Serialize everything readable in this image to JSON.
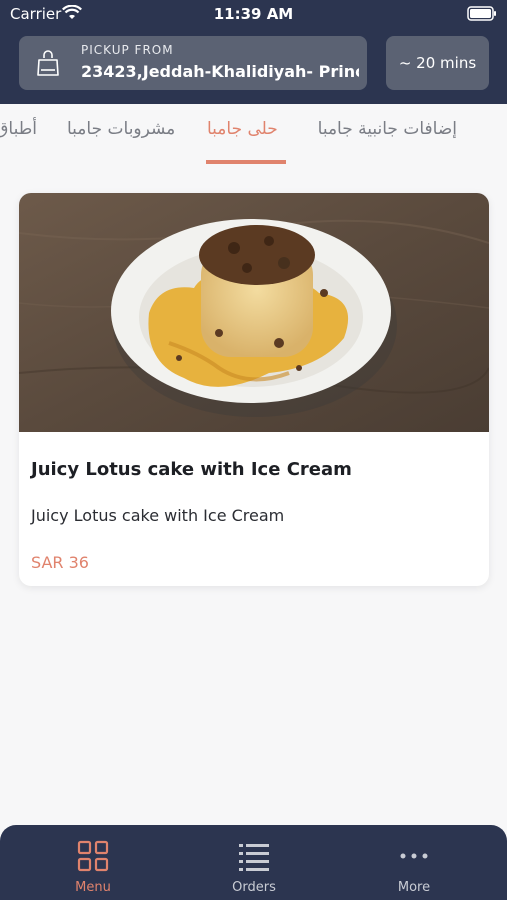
{
  "status_bar": {
    "carrier": "Carrier",
    "time": "11:39 AM"
  },
  "header": {
    "pickup_label": "PICKUP FROM",
    "pickup_address": "23423,Jeddah-Khalidiyah- Princ...",
    "eta": "~ 20 mins"
  },
  "tabs": [
    {
      "label": "إضافات جانبية جامبا",
      "active": false
    },
    {
      "label": "حلى جامبا",
      "active": true
    },
    {
      "label": "مشروبات جامبا",
      "active": false
    },
    {
      "label": "أطباق",
      "active": false
    }
  ],
  "product": {
    "title": "Juicy Lotus cake with Ice Cream",
    "description": "Juicy Lotus cake with Ice Cream",
    "price": "SAR 36"
  },
  "bottom_nav": [
    {
      "label": "Menu",
      "icon": "grid-icon",
      "active": true
    },
    {
      "label": "Orders",
      "icon": "list-icon",
      "active": false
    },
    {
      "label": "More",
      "icon": "more-dots-icon",
      "active": false
    }
  ],
  "colors": {
    "header_bg": "#2c3550",
    "accent": "#e0836d",
    "chip_bg": "#5b6273"
  }
}
